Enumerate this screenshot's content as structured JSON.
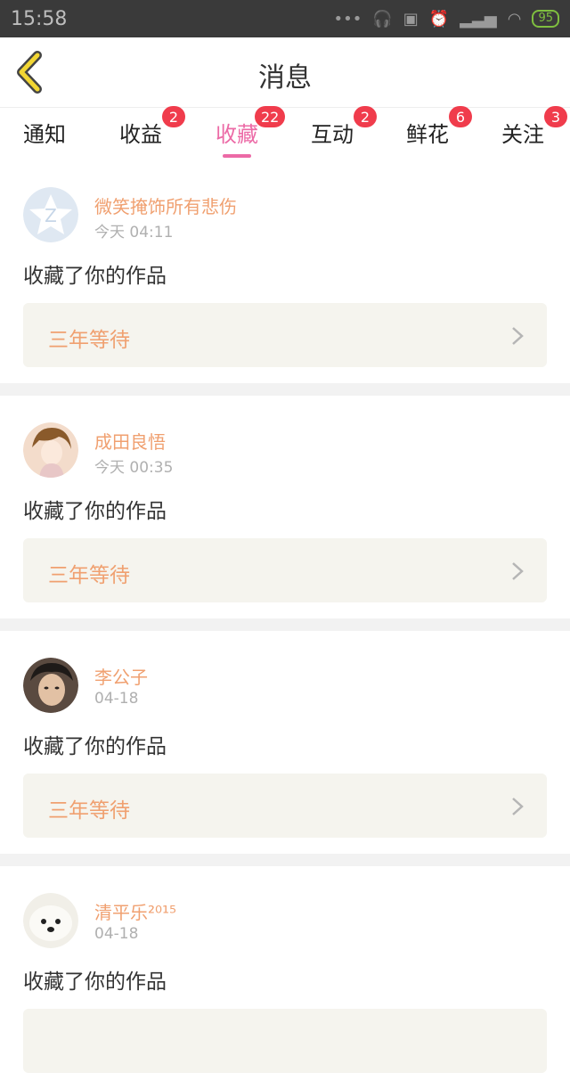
{
  "status": {
    "time": "15:58",
    "battery": "95"
  },
  "nav": {
    "title": "消息"
  },
  "tabs": [
    {
      "label": "通知",
      "badge": ""
    },
    {
      "label": "收益",
      "badge": "2"
    },
    {
      "label": "收藏",
      "badge": "22"
    },
    {
      "label": "互动",
      "badge": "2"
    },
    {
      "label": "鲜花",
      "badge": "6"
    },
    {
      "label": "关注",
      "badge": "3"
    }
  ],
  "messages": [
    {
      "user": "微笑掩饰所有悲伤",
      "time": "今天 04:11",
      "action": "收藏了你的作品",
      "work": "三年等待"
    },
    {
      "user": "成田良悟",
      "time": "今天 00:35",
      "action": "收藏了你的作品",
      "work": "三年等待"
    },
    {
      "user": "李公子",
      "time": "04-18",
      "action": "收藏了你的作品",
      "work": "三年等待"
    },
    {
      "user": "清平乐²⁰¹⁵",
      "time": "04-18",
      "action": "收藏了你的作品",
      "work": ""
    }
  ],
  "colors": {
    "accent": "#ec6aa6",
    "badge": "#f03c4c",
    "username": "#f0a070"
  }
}
